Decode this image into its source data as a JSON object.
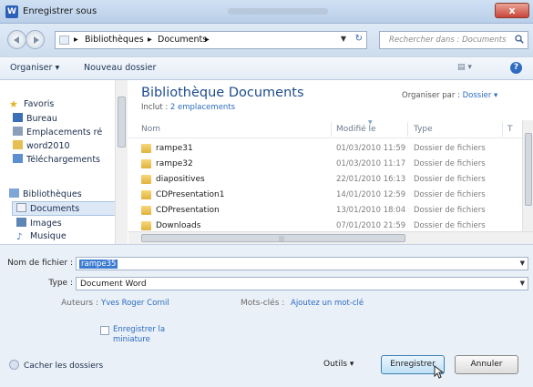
{
  "window": {
    "title": "Enregistrer sous",
    "app_icon_letter": "W",
    "close_label": "x"
  },
  "address_bar": {
    "crumbs": [
      "Bibliothèques",
      "Documents"
    ],
    "search_placeholder": "Rechercher dans : Documents"
  },
  "toolbar": {
    "organize_label": "Organiser ▾",
    "new_folder_label": "Nouveau dossier"
  },
  "nav_pane": {
    "items": [
      {
        "label": "Favoris",
        "icon": "star-icon"
      },
      {
        "label": "Bureau",
        "icon": "desktop-icon"
      },
      {
        "label": "Emplacements ré",
        "icon": "recent-places-icon"
      },
      {
        "label": "word2010",
        "icon": "folder-icon"
      },
      {
        "label": "Téléchargements",
        "icon": "downloads-icon"
      },
      {
        "label": "Bibliothèques",
        "icon": "libraries-icon"
      },
      {
        "label": "Documents",
        "icon": "documents-icon"
      },
      {
        "label": "Images",
        "icon": "images-icon"
      },
      {
        "label": "Musique",
        "icon": "music-icon"
      }
    ],
    "selected": "Documents"
  },
  "library": {
    "title": "Bibliothèque Documents",
    "includes_label": "Inclut :",
    "includes_link": "2 emplacements",
    "arrange_label": "Organiser par :",
    "arrange_value": "Dossier ▾"
  },
  "columns": {
    "name": "Nom",
    "modified": "Modifié le",
    "type": "Type",
    "extra": "T"
  },
  "files": [
    {
      "name": "rampe31",
      "date": "01/03/2010 11:59",
      "type": "Dossier de fichiers"
    },
    {
      "name": "rampe32",
      "date": "01/03/2010 11:17",
      "type": "Dossier de fichiers"
    },
    {
      "name": "diapositives",
      "date": "22/01/2010 16:13",
      "type": "Dossier de fichiers"
    },
    {
      "name": "CDPresentation1",
      "date": "14/01/2010 12:59",
      "type": "Dossier de fichiers"
    },
    {
      "name": "CDPresentation",
      "date": "13/01/2010 18:04",
      "type": "Dossier de fichiers"
    },
    {
      "name": "Downloads",
      "date": "07/01/2010 21:59",
      "type": "Dossier de fichiers"
    }
  ],
  "form": {
    "filename_label": "Nom de fichier :",
    "filename_value": "rampe35",
    "type_label": "Type :",
    "type_value": "Document Word",
    "authors_label": "Auteurs :",
    "authors_value": "Yves Roger Cornil",
    "keywords_label": "Mots-clés :",
    "keywords_value": "Ajoutez un mot-clé",
    "thumbnail_label_1": "Enregistrer la",
    "thumbnail_label_2": "miniature"
  },
  "footer": {
    "hide_folders_label": "Cacher les dossiers",
    "tools_label": "Outils",
    "save_label": "Enregistrer",
    "cancel_label": "Annuler"
  },
  "colors": {
    "accent": "#1c4d8b",
    "link": "#2a6bc1",
    "selection": "#3b7bd1",
    "close": "#c9473a"
  }
}
